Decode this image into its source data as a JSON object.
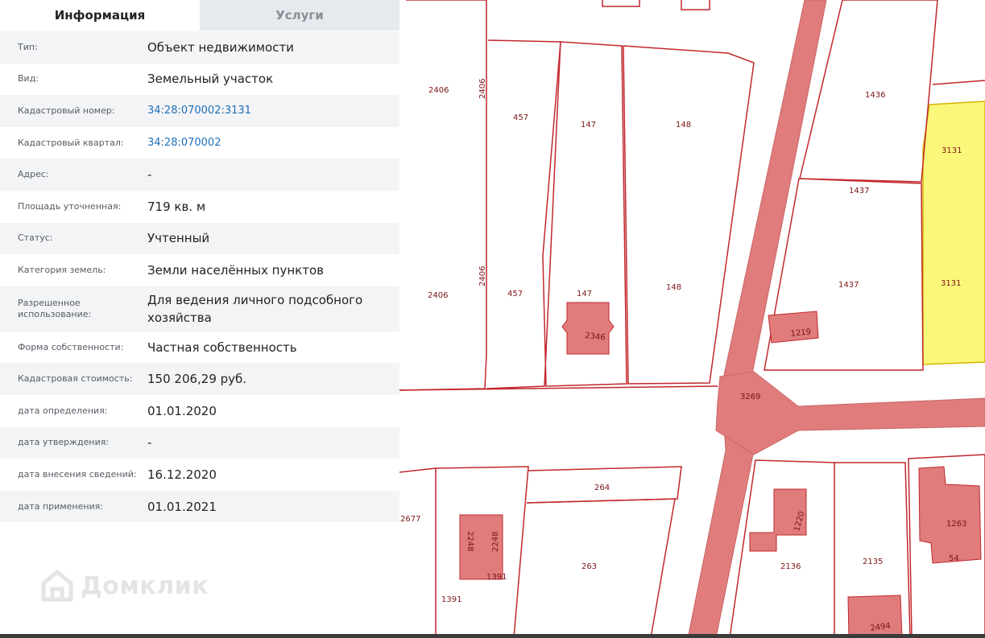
{
  "tabs": {
    "info": "Информация",
    "services": "Услуги"
  },
  "info": {
    "type_label": "Тип:",
    "type_value": "Объект недвижимости",
    "kind_label": "Вид:",
    "kind_value": "Земельный участок",
    "cad_number_label": "Кадастровый номер:",
    "cad_number_value": "34:28:070002:3131",
    "cad_quarter_label": "Кадастровый квартал:",
    "cad_quarter_value": "34:28:070002",
    "address_label": "Адрес:",
    "address_value": "-",
    "area_label": "Площадь уточненная:",
    "area_value": "719 кв. м",
    "status_label": "Статус:",
    "status_value": "Учтенный",
    "category_label": "Категория земель:",
    "category_value": "Земли населённых пунктов",
    "permitted_use_label": "Разрешенное использование:",
    "permitted_use_value": "Для ведения личного подсобного хозяйства",
    "ownership_label": "Форма собственности:",
    "ownership_value": "Частная собственность",
    "cad_cost_label": "Кадастровая стоимость:",
    "cad_cost_value": "150 206,29 руб.",
    "determination_date_label": "дата определения:",
    "determination_date_value": "01.01.2020",
    "approval_date_label": "дата утверждения:",
    "approval_date_value": "-",
    "entry_date_label": "дата внесения сведений:",
    "entry_date_value": "16.12.2020",
    "application_date_label": "дата применения:",
    "application_date_value": "01.01.2021"
  },
  "watermark": "Домклик",
  "map": {
    "colors": {
      "parcel_border": "#c1272d",
      "building_fill": "#e07c7c",
      "road_fill": "#e07c7c",
      "selected_fill": "#fbf77a",
      "selected_border": "#d2b400",
      "label": "#7b1515"
    },
    "labels": {
      "p2406a": "2406",
      "p2406v1": "2406",
      "p2406b": "2406",
      "p2406v2": "2406",
      "p457a": "457",
      "p457b": "457",
      "p147a": "147",
      "p147b": "147",
      "p148a": "148",
      "p148b": "148",
      "p2346": "2346",
      "p1436": "1436",
      "p3131a": "3131",
      "p3131b": "3131",
      "p1437a": "1437",
      "p1437b": "1437",
      "p1219": "1219",
      "p3269": "3269",
      "p264": "264",
      "p263": "263",
      "p2677": "2677",
      "p2248a": "2248",
      "p2248b": "2248",
      "p1391a": "1391",
      "p1391b": "1391",
      "p1220": "1220",
      "p2136": "2136",
      "p2135": "2135",
      "p1263": "1263",
      "p54": "54",
      "p2494": "2494"
    }
  }
}
